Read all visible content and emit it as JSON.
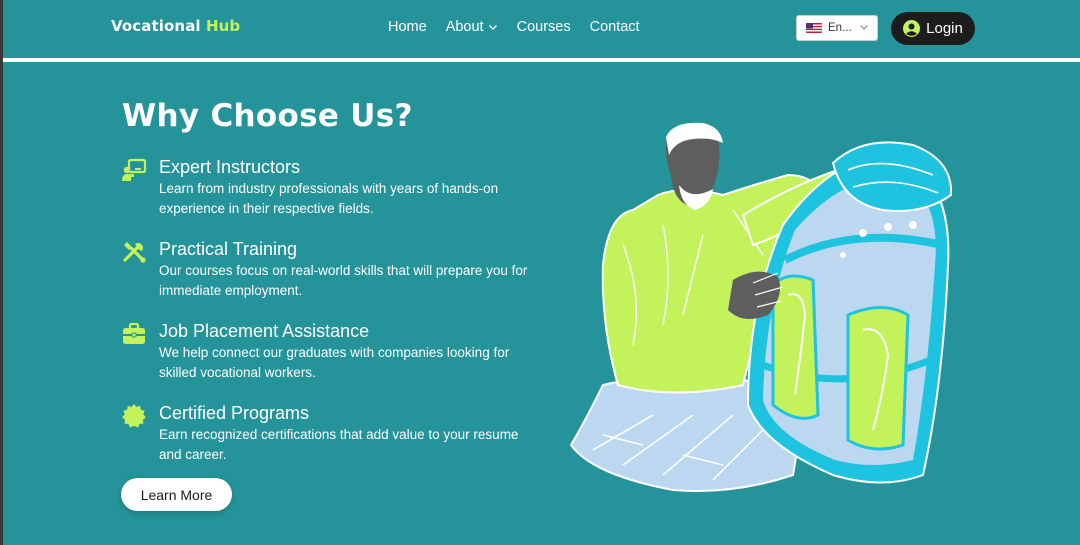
{
  "brand": {
    "name_main": "Vocational",
    "name_accent": "Hub"
  },
  "nav": {
    "home": "Home",
    "about": "About",
    "courses": "Courses",
    "contact": "Contact"
  },
  "language": {
    "selected": "En..."
  },
  "login_label": "Login",
  "hero": {
    "title": "Why Choose Us?",
    "features": [
      {
        "title": "Expert Instructors",
        "description": "Learn from industry professionals with years of hands-on experience in their respective fields.",
        "icon": "chalkboard-teacher-icon"
      },
      {
        "title": "Practical Training",
        "description": "Our courses focus on real-world skills that will prepare you for immediate employment.",
        "icon": "tools-icon"
      },
      {
        "title": "Job Placement Assistance",
        "description": "We help connect our graduates with companies looking for skilled vocational workers.",
        "icon": "briefcase-icon"
      },
      {
        "title": "Certified Programs",
        "description": "Earn recognized certifications that add value to your resume and career.",
        "icon": "certificate-icon"
      }
    ],
    "cta_label": "Learn More"
  },
  "colors": {
    "background": "#24949a",
    "accent": "#c4f25a",
    "login_bg": "#1c1c1c"
  }
}
